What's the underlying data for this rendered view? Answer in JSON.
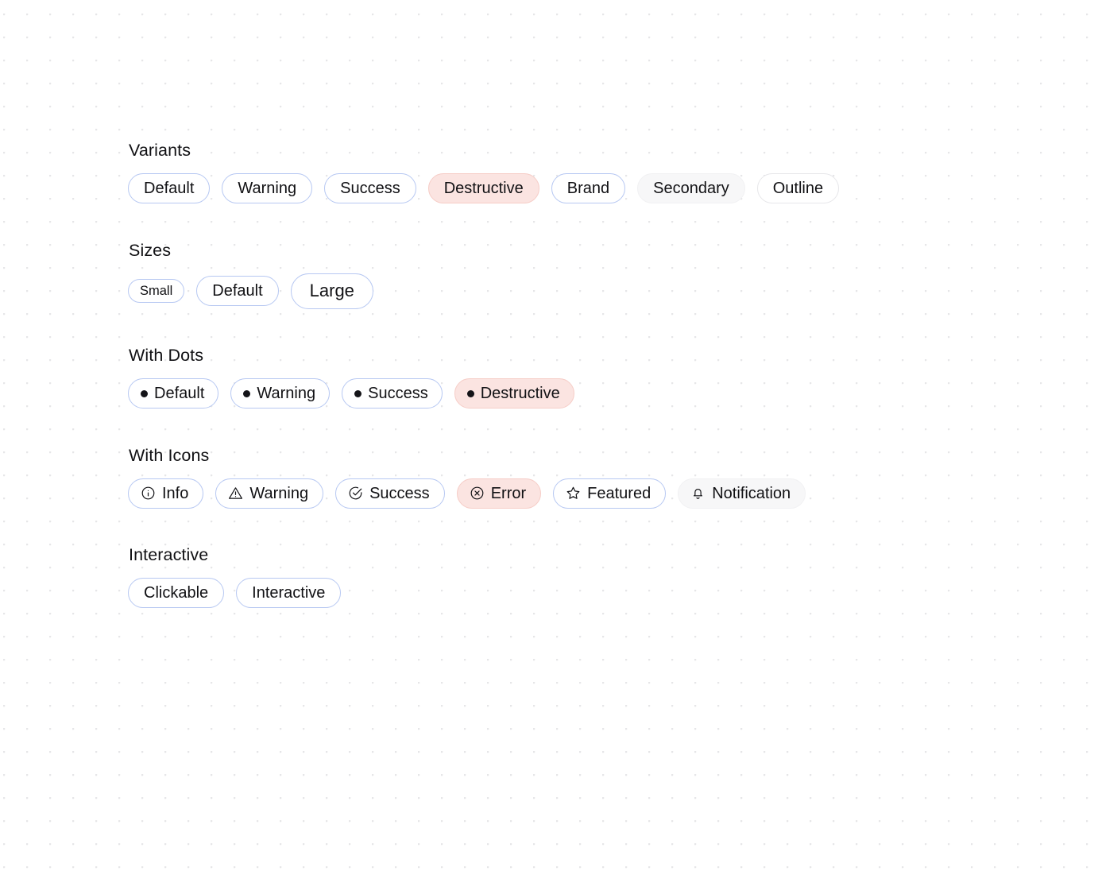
{
  "sections": [
    {
      "id": "variants",
      "title": "Variants",
      "badges": [
        {
          "label": "Default",
          "variant": "default",
          "icon": null,
          "dot": false
        },
        {
          "label": "Warning",
          "variant": "warning",
          "icon": null,
          "dot": false
        },
        {
          "label": "Success",
          "variant": "success",
          "icon": null,
          "dot": false
        },
        {
          "label": "Destructive",
          "variant": "destructive",
          "icon": null,
          "dot": false
        },
        {
          "label": "Brand",
          "variant": "brand",
          "icon": null,
          "dot": false
        },
        {
          "label": "Secondary",
          "variant": "secondary",
          "icon": null,
          "dot": false
        },
        {
          "label": "Outline",
          "variant": "outline",
          "icon": null,
          "dot": false
        }
      ]
    },
    {
      "id": "sizes",
      "title": "Sizes",
      "badges": [
        {
          "label": "Small",
          "variant": "default",
          "size": "small",
          "icon": null,
          "dot": false
        },
        {
          "label": "Default",
          "variant": "default",
          "size": "default",
          "icon": null,
          "dot": false
        },
        {
          "label": "Large",
          "variant": "default",
          "size": "large",
          "icon": null,
          "dot": false
        }
      ]
    },
    {
      "id": "with-dots",
      "title": "With Dots",
      "badges": [
        {
          "label": "Default",
          "variant": "default",
          "icon": null,
          "dot": true
        },
        {
          "label": "Warning",
          "variant": "warning",
          "icon": null,
          "dot": true
        },
        {
          "label": "Success",
          "variant": "success",
          "icon": null,
          "dot": true
        },
        {
          "label": "Destructive",
          "variant": "destructive",
          "icon": null,
          "dot": true
        }
      ]
    },
    {
      "id": "with-icons",
      "title": "With Icons",
      "badges": [
        {
          "label": "Info",
          "variant": "default",
          "icon": "info-circle-icon",
          "dot": false
        },
        {
          "label": "Warning",
          "variant": "warning",
          "icon": "alert-triangle-icon",
          "dot": false
        },
        {
          "label": "Success",
          "variant": "success",
          "icon": "check-circle-icon",
          "dot": false
        },
        {
          "label": "Error",
          "variant": "destructive",
          "icon": "x-circle-icon",
          "dot": false
        },
        {
          "label": "Featured",
          "variant": "brand",
          "icon": "star-icon",
          "dot": false
        },
        {
          "label": "Notification",
          "variant": "secondary",
          "icon": "bell-icon",
          "dot": false
        }
      ]
    },
    {
      "id": "interactive",
      "title": "Interactive",
      "badges": [
        {
          "label": "Clickable",
          "variant": "default",
          "icon": null,
          "dot": false
        },
        {
          "label": "Interactive",
          "variant": "default",
          "icon": null,
          "dot": false
        }
      ]
    }
  ],
  "colors": {
    "page_background": "#ffffff",
    "grid_dot": "#e6e6e8",
    "text": "#111114",
    "border_accent": "#b7c8f2",
    "destructive_background": "#fbe4e1",
    "destructive_border": "#f6cdc7",
    "secondary_background": "#f7f7f8",
    "outline_border": "#e7e7ea",
    "dot": "#141418"
  }
}
